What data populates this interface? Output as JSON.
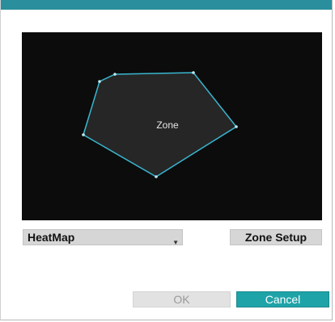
{
  "preview": {
    "zone_label": "Zone",
    "zone_outline_color": "#39b7d0",
    "zone_fill_color": "#262626"
  },
  "controls": {
    "mode_select_value": "HeatMap",
    "zone_setup_label": "Zone Setup"
  },
  "footer": {
    "ok_label": "OK",
    "cancel_label": "Cancel"
  },
  "colors": {
    "accent": "#1ea3a8",
    "title_bar": "#2a8e9c"
  }
}
